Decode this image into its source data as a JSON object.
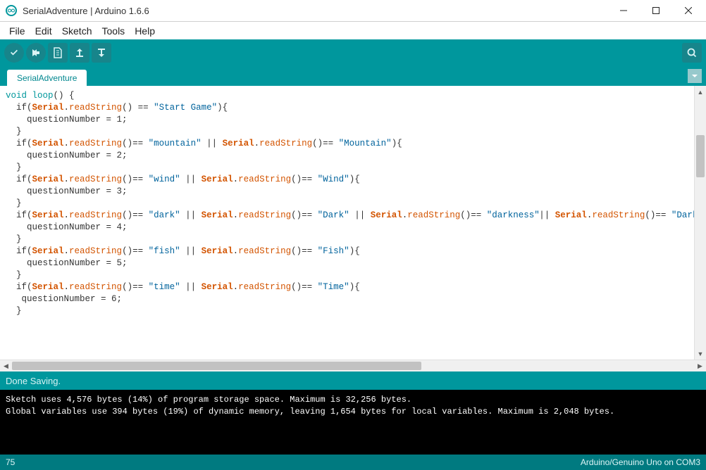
{
  "window": {
    "title": "SerialAdventure | Arduino 1.6.6"
  },
  "menu": {
    "file": "File",
    "edit": "Edit",
    "sketch": "Sketch",
    "tools": "Tools",
    "help": "Help"
  },
  "tab": {
    "name": "SerialAdventure"
  },
  "code": {
    "line1_void": "void",
    "line1_loop": " loop",
    "line1_rest": "() {",
    "line2a": "  if(",
    "line2_serial": "Serial",
    "line2_dot": ".",
    "line2_read": "readString",
    "line2_paren": "() == ",
    "line2_str": "\"Start Game\"",
    "line2_end": "){",
    "line3": "    questionNumber = 1;",
    "line4": "  }",
    "line5a": "  if(",
    "line5_eq": "()== ",
    "line5_s1": "\"mountain\"",
    "line5_or": " || ",
    "line5_s2": "\"Mountain\"",
    "line5_end": "){",
    "line6": "    questionNumber = 2;",
    "line7": "  }",
    "line8_s1": "\"wind\"",
    "line8_s2": "\"Wind\"",
    "line9": "    questionNumber = 3;",
    "line10": "  }",
    "line11_s1": "\"dark\"",
    "line11_s2": "\"Dark\"",
    "line11_s3": "\"darkness\"",
    "line11_s4": "\"Darkness\"",
    "line12": "    questionNumber = 4;",
    "line13": "  }",
    "line14_s1": "\"fish\"",
    "line14_s2": "\"Fish\"",
    "line15": "    questionNumber = 5;",
    "line16": "  }",
    "line17_s1": "\"time\"",
    "line17_s2": "\"Time\"",
    "line18": "   questionNumber = 6;",
    "line19": "  }"
  },
  "status": {
    "message": "Done Saving."
  },
  "console": {
    "line1": "Sketch uses 4,576 bytes (14%) of program storage space. Maximum is 32,256 bytes.",
    "line2": "Global variables use 394 bytes (19%) of dynamic memory, leaving 1,654 bytes for local variables. Maximum is 2,048 bytes."
  },
  "footer": {
    "line": "75",
    "board": "Arduino/Genuino Uno on COM3"
  }
}
